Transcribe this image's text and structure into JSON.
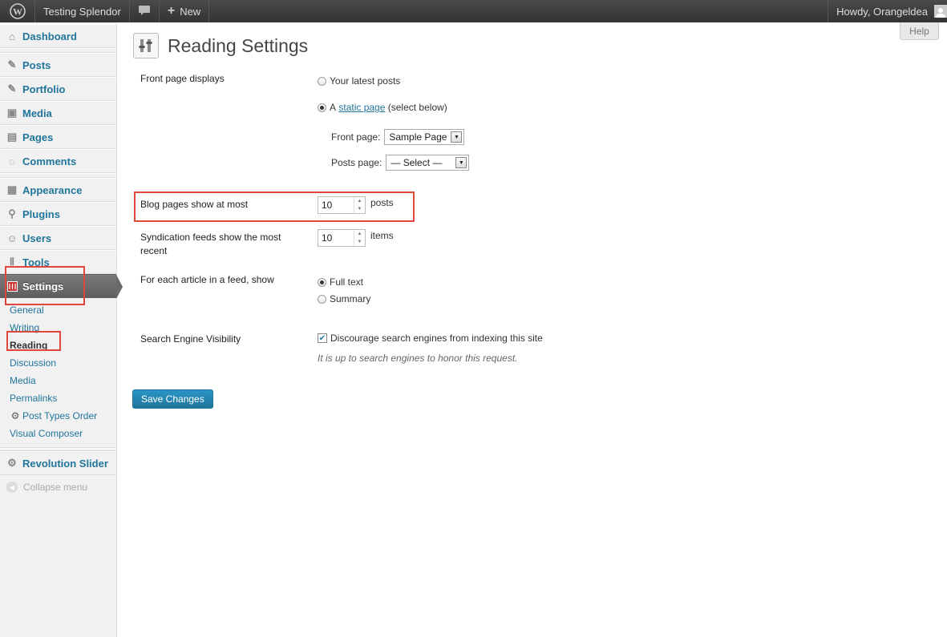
{
  "adminbar": {
    "site_name": "Testing Splendor",
    "new_label": "New",
    "greeting": "Howdy, Orangeldea"
  },
  "sidebar": {
    "items": [
      {
        "label": "Dashboard",
        "icon": "house-icon"
      },
      {
        "label": "Posts",
        "icon": "pin-icon"
      },
      {
        "label": "Portfolio",
        "icon": "pin-icon"
      },
      {
        "label": "Media",
        "icon": "media-icon"
      },
      {
        "label": "Pages",
        "icon": "pages-icon"
      },
      {
        "label": "Comments",
        "icon": "comment-icon"
      },
      {
        "label": "Appearance",
        "icon": "appearance-icon"
      },
      {
        "label": "Plugins",
        "icon": "plug-icon"
      },
      {
        "label": "Users",
        "icon": "users-icon"
      },
      {
        "label": "Tools",
        "icon": "tools-icon"
      },
      {
        "label": "Settings",
        "icon": "settings-icon"
      }
    ],
    "submenu": [
      "General",
      "Writing",
      "Reading",
      "Discussion",
      "Media",
      "Permalinks",
      "Post Types Order",
      "Visual Composer"
    ],
    "revolution_slider": "Revolution Slider",
    "collapse": "Collapse menu"
  },
  "help": "Help",
  "page": {
    "title": "Reading Settings",
    "front_page_displays": {
      "label": "Front page displays",
      "opt_latest": "Your latest posts",
      "opt_static_prefix": "A",
      "opt_static_link": "static page",
      "opt_static_suffix": "(select below)",
      "selected": "static page",
      "front_page_label": "Front page:",
      "front_page_value": "Sample Page",
      "posts_page_label": "Posts page:",
      "posts_page_value": "— Select —"
    },
    "blog_pages": {
      "label": "Blog pages show at most",
      "value": "10",
      "unit": "posts"
    },
    "syndication": {
      "label_line1": "Syndication feeds show the most",
      "label_line2": "recent",
      "value": "10",
      "unit": "items"
    },
    "feed_article": {
      "label": "For each article in a feed, show",
      "opt_full": "Full text",
      "opt_summary": "Summary",
      "selected": "Full text"
    },
    "search_visibility": {
      "label": "Search Engine Visibility",
      "checkbox_label": "Discourage search engines from indexing this site",
      "checked": true,
      "description": "It is up to search engines to honor this request."
    },
    "save_button": "Save Changes"
  },
  "colors": {
    "link": "#21759b",
    "highlight": "#e0473c",
    "button": "#21759b"
  }
}
